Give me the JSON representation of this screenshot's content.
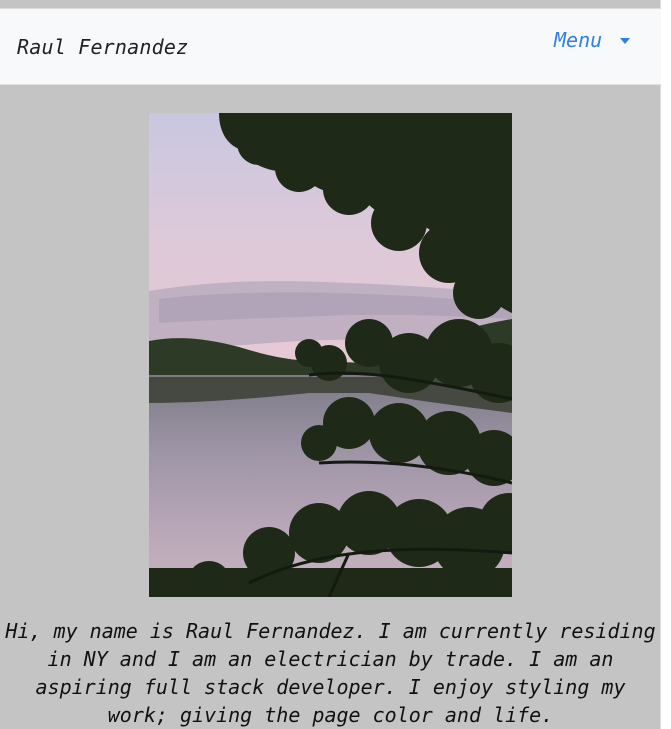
{
  "navbar": {
    "brand": "Raul Fernandez",
    "menu_label": "Menu",
    "menu_icon": "chevron-down-icon"
  },
  "hero": {
    "image_subject": "lake-at-dusk-with-trees"
  },
  "bio": {
    "text": "Hi, my name is Raul Fernandez. I am currently residing in NY and I am an electrician by trade. I am an aspiring full stack developer. I enjoy styling my work; giving the page color and life."
  },
  "colors": {
    "background": "#c4c4c4",
    "navbar_bg": "#f8f9fa",
    "accent": "#2f7fe6"
  }
}
